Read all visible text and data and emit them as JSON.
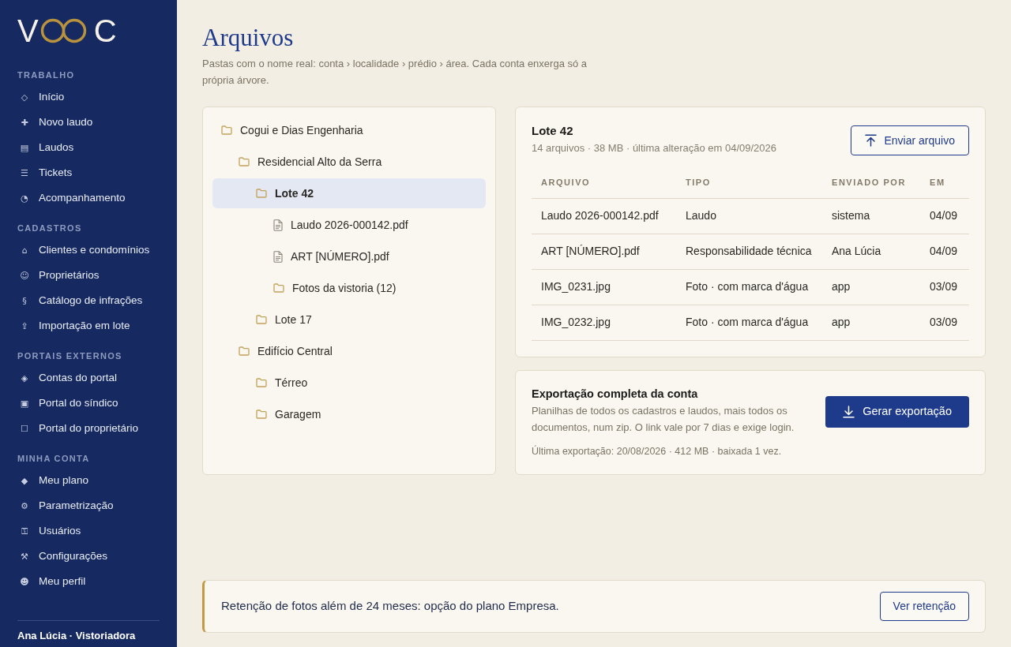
{
  "sidebar": {
    "logo": {
      "start": "V",
      "end": "C"
    },
    "sections": [
      {
        "heading": "TRABALHO",
        "items": [
          {
            "icon": "◇",
            "label": "Início"
          },
          {
            "icon": "✚",
            "label": "Novo laudo"
          },
          {
            "icon": "▤",
            "label": "Laudos"
          },
          {
            "icon": "☰",
            "label": "Tickets"
          },
          {
            "icon": "◔",
            "label": "Acompanhamento"
          }
        ]
      },
      {
        "heading": "CADASTROS",
        "items": [
          {
            "icon": "⌂",
            "label": "Clientes e condomínios"
          },
          {
            "icon": "☺",
            "label": "Proprietários"
          },
          {
            "icon": "§",
            "label": "Catálogo de infrações"
          },
          {
            "icon": "⇪",
            "label": "Importação em lote"
          }
        ]
      },
      {
        "heading": "PORTAIS EXTERNOS",
        "items": [
          {
            "icon": "◈",
            "label": "Contas do portal"
          },
          {
            "icon": "▣",
            "label": "Portal do síndico"
          },
          {
            "icon": "☐",
            "label": "Portal do proprietário"
          }
        ]
      },
      {
        "heading": "MINHA CONTA",
        "items": [
          {
            "icon": "◆",
            "label": "Meu plano"
          },
          {
            "icon": "⚙",
            "label": "Parametrização"
          },
          {
            "icon": "⚿",
            "label": "Usuários"
          },
          {
            "icon": "⚒",
            "label": "Configurações"
          },
          {
            "icon": "☻",
            "label": "Meu perfil"
          }
        ]
      }
    ],
    "user": "Ana Lúcia · Vistoriadora"
  },
  "header": {
    "title": "Arquivos",
    "subtitle": "Pastas com o nome real: conta › localidade › prédio › área. Cada conta enxerga só a própria árvore."
  },
  "folder_tree": [
    {
      "kind": "folder",
      "label": "Cogui e Dias Engenharia",
      "selected": false,
      "children": [
        {
          "kind": "folder",
          "label": "Residencial Alto da Serra",
          "selected": false,
          "children": [
            {
              "kind": "folder",
              "label": "Lote 42",
              "selected": true,
              "children": [
                {
                  "kind": "file",
                  "label": "Laudo 2026-000142.pdf",
                  "selected": false
                },
                {
                  "kind": "file",
                  "label": "ART [NÚMERO].pdf",
                  "selected": false
                },
                {
                  "kind": "folder",
                  "label": "Fotos da vistoria (12)",
                  "selected": false
                }
              ]
            },
            {
              "kind": "folder",
              "label": "Lote 17",
              "selected": false
            }
          ]
        },
        {
          "kind": "folder",
          "label": "Edifício Central",
          "selected": false,
          "children": [
            {
              "kind": "folder",
              "label": "Térreo",
              "selected": false
            },
            {
              "kind": "folder",
              "label": "Garagem",
              "selected": false
            }
          ]
        }
      ]
    }
  ],
  "folder_details": {
    "title": "Lote 42",
    "meta": "14 arquivos · 38 MB · última alteração em 04/09/2026",
    "upload_button": "Enviar arquivo",
    "table": {
      "columns": [
        "ARQUIVO",
        "TIPO",
        "ENVIADO POR",
        "EM"
      ],
      "rows": [
        [
          "Laudo 2026-000142.pdf",
          "Laudo",
          "sistema",
          "04/09"
        ],
        [
          "ART [NÚMERO].pdf",
          "Responsabilidade técnica",
          "Ana Lúcia",
          "04/09"
        ],
        [
          "IMG_0231.jpg",
          "Foto · com marca d'água",
          "app",
          "03/09"
        ],
        [
          "IMG_0232.jpg",
          "Foto · com marca d'água",
          "app",
          "03/09"
        ]
      ]
    }
  },
  "export": {
    "title": "Exportação completa da conta",
    "description": "Planilhas de todos os cadastros e laudos, mais todos os documentos, num zip. O link vale por 7 dias e exige login.",
    "last_export": "Última exportação: 20/08/2026 · 412 MB · baixada 1 vez.",
    "button": "Gerar exportação"
  },
  "retention_banner": {
    "message": "Retenção de fotos além de 24 meses: opção do plano Empresa.",
    "button": "Ver retenção"
  }
}
